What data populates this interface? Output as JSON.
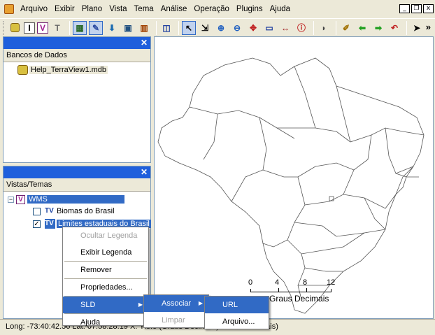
{
  "menu": {
    "items": [
      "Arquivo",
      "Exibir",
      "Plano",
      "Vista",
      "Tema",
      "Análise",
      "Operação",
      "Plugins",
      "Ajuda"
    ],
    "underline": [
      "A",
      "E",
      "P",
      "V",
      "T",
      "n",
      "O",
      "P",
      "j"
    ]
  },
  "window_controls": [
    "_",
    "❐",
    "x"
  ],
  "toolbar": {
    "buttons": [
      "db",
      "I",
      "V",
      "T",
      "layers",
      "edit",
      "tag",
      "view",
      "table",
      "grid",
      "pointer",
      "zoom-area",
      "zoom-in",
      "zoom-out",
      "pan",
      "rect",
      "measure",
      "info",
      "shape",
      "pen",
      "arrow-left",
      "arrow-right",
      "undo",
      "cursor"
    ],
    "more": "»"
  },
  "db_panel": {
    "column": "Bancos de Dados",
    "items": [
      {
        "label": "Help_TerraView1.mdb"
      }
    ]
  },
  "views_panel": {
    "column": "Vistas/Temas",
    "view": {
      "label": "WMS",
      "expander": "−"
    },
    "themes": [
      {
        "label": "Biomas do Brasil",
        "checked": false
      },
      {
        "label": "Limites estaduais do Brasil",
        "checked": true
      }
    ]
  },
  "context_menu": {
    "items": [
      {
        "label": "Ocultar Legenda",
        "disabled": true
      },
      {
        "label": "Exibir Legenda",
        "disabled": false
      },
      {
        "label": "Remover",
        "disabled": false
      },
      {
        "label": "Propriedades...",
        "disabled": false
      },
      {
        "label": "SLD",
        "disabled": false,
        "submenu": true
      },
      {
        "label": "Ajuda",
        "disabled": false
      }
    ]
  },
  "sld_submenu": {
    "items": [
      {
        "label": "Associar",
        "disabled": false,
        "submenu": true
      },
      {
        "label": "Limpar",
        "disabled": true
      }
    ]
  },
  "associar_submenu": {
    "items": [
      {
        "label": "URL",
        "disabled": false
      },
      {
        "label": "Arquivo...",
        "disabled": false
      }
    ]
  },
  "map": {
    "scale_ticks": [
      "0",
      "4",
      "8",
      "12"
    ],
    "scale_units": "Graus Decimais"
  },
  "status": {
    "text": "Long: -73:40:42.56 Lat: 07:58:28.19  X: Ylofo  (Graus Decimais) Graus Decimais)"
  }
}
